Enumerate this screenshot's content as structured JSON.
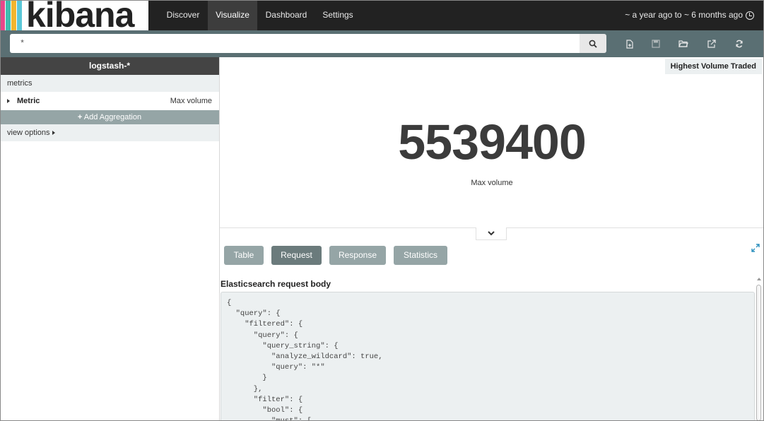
{
  "brand": {
    "logo_text": "kibana",
    "stripe_colors": [
      "#e8488b",
      "#3ebeb0",
      "#f2b52e",
      "#5ac7d7"
    ]
  },
  "nav": {
    "tabs": [
      {
        "label": "Discover"
      },
      {
        "label": "Visualize"
      },
      {
        "label": "Dashboard"
      },
      {
        "label": "Settings"
      }
    ],
    "active_tab": "Visualize",
    "time_range": "~ a year ago to ~ 6 months ago"
  },
  "search": {
    "query": "*"
  },
  "toolbar_icons": [
    "new-visualization-icon",
    "save-icon",
    "open-folder-icon",
    "share-icon",
    "refresh-icon"
  ],
  "sidebar": {
    "index_pattern": "logstash-*",
    "metrics_section": "metrics",
    "metric": {
      "label": "Metric",
      "value": "Max volume"
    },
    "add_aggregation": "Add Aggregation",
    "view_options": "view options"
  },
  "visualization": {
    "title": "Highest Volume Traded",
    "metric_value": "5539400",
    "metric_label": "Max volume"
  },
  "spy": {
    "tabs": [
      {
        "label": "Table"
      },
      {
        "label": "Request"
      },
      {
        "label": "Response"
      },
      {
        "label": "Statistics"
      }
    ],
    "active_tab": "Request",
    "section_title": "Elasticsearch request body",
    "code": "{\n  \"query\": {\n    \"filtered\": {\n      \"query\": {\n        \"query_string\": {\n          \"analyze_wildcard\": true,\n          \"query\": \"*\"\n        }\n      },\n      \"filter\": {\n        \"bool\": {\n          \"must\": ["
  },
  "colors": {
    "nav_bg": "#222222",
    "search_bar_bg": "#5a6f73",
    "panel_bg": "#ecf0f1",
    "button_bg": "#95a5a6",
    "active_button_bg": "#6b7b7c"
  }
}
